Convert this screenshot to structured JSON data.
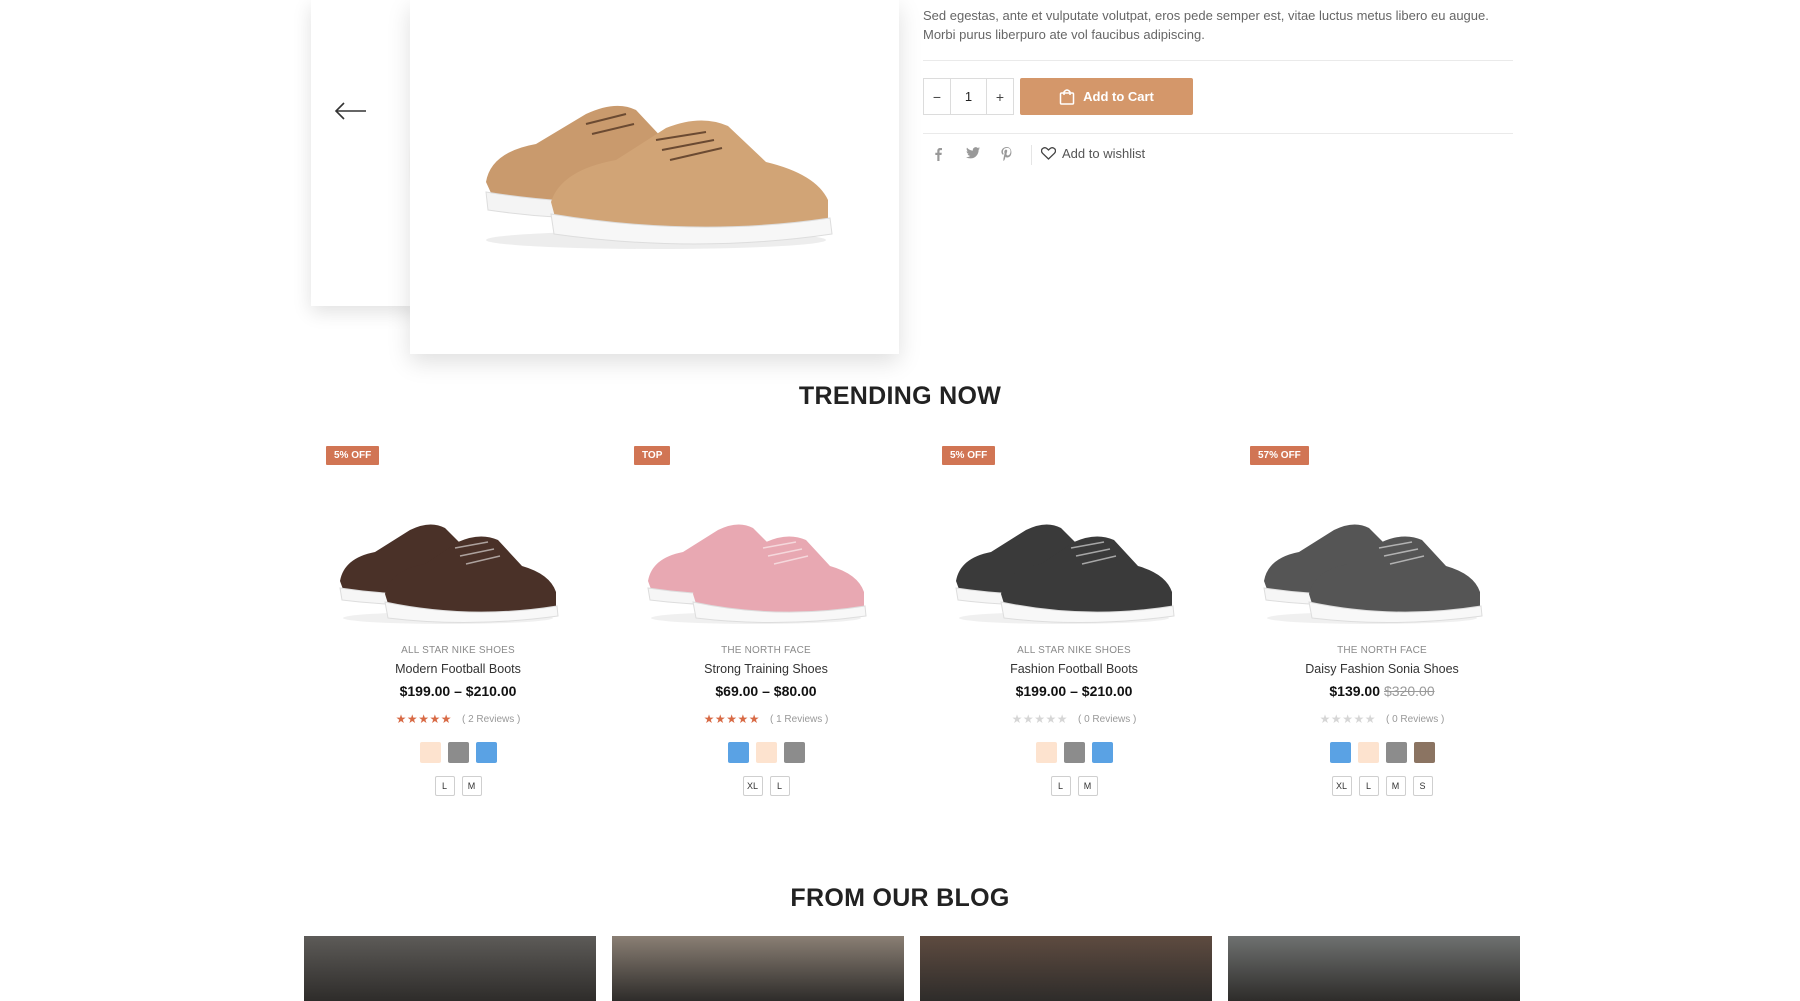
{
  "product": {
    "description_line1": "Sed egestas, ante et vulputate volutpat, eros pede semper est, vitae luctus metus libero eu augue.",
    "description_line2": "Morbi purus liberpuro ate vol faucibus adipiscing.",
    "quantity": "1",
    "qty_minus": "−",
    "qty_plus": "+",
    "add_to_cart": "Add to Cart",
    "wishlist": "Add to wishlist",
    "share_icons": [
      "facebook-icon",
      "twitter-icon",
      "pinterest-icon"
    ],
    "accent_color": "#d4976a"
  },
  "trending": {
    "title": "TRENDING NOW",
    "products": [
      {
        "badge": "5% OFF",
        "brand": "ALL STAR NIKE SHOES",
        "name": "Modern Football Boots",
        "price": "$199.00 – $210.00",
        "old_price": "",
        "stars": 4.5,
        "reviews": "( 2 Reviews )",
        "colors": [
          "#fde3cf",
          "#8c8c8c",
          "#5aa2e4"
        ],
        "sizes": [
          "L",
          "M"
        ],
        "shoe_color": "#4a3128"
      },
      {
        "badge": "TOP",
        "brand": "THE NORTH FACE",
        "name": "Strong Training Shoes",
        "price": "$69.00 – $80.00",
        "old_price": "",
        "stars": 5,
        "reviews": "( 1 Reviews )",
        "colors": [
          "#5aa2e4",
          "#fde3cf",
          "#8c8c8c"
        ],
        "sizes": [
          "XL",
          "L"
        ],
        "shoe_color": "#e8a8b2"
      },
      {
        "badge": "5% OFF",
        "brand": "ALL STAR NIKE SHOES",
        "name": "Fashion Football Boots",
        "price": "$199.00 – $210.00",
        "old_price": "",
        "stars": 0,
        "reviews": "( 0 Reviews )",
        "colors": [
          "#fde3cf",
          "#8c8c8c",
          "#5aa2e4"
        ],
        "sizes": [
          "L",
          "M"
        ],
        "shoe_color": "#3a3a3a"
      },
      {
        "badge": "57% OFF",
        "brand": "THE NORTH FACE",
        "name": "Daisy Fashion Sonia Shoes",
        "price": "$139.00",
        "old_price": "$320.00",
        "stars": 0,
        "reviews": "( 0 Reviews )",
        "colors": [
          "#5aa2e4",
          "#fde3cf",
          "#8c8c8c",
          "#8b7462"
        ],
        "sizes": [
          "XL",
          "L",
          "M",
          "S"
        ],
        "shoe_color": "#555555"
      }
    ],
    "star_color": "#d86a45",
    "badge_color": "#d17554"
  },
  "blog": {
    "title": "FROM OUR BLOG",
    "posts": [
      {
        "image": "white-sneaker-photo",
        "tone": "#5d5b58"
      },
      {
        "image": "legs-cafe-photo",
        "tone": "#8a7f74"
      },
      {
        "image": "boots-wood-photo",
        "tone": "#5e4b40"
      },
      {
        "image": "neon-sneakers-photo",
        "tone": "#6f7170"
      }
    ]
  }
}
